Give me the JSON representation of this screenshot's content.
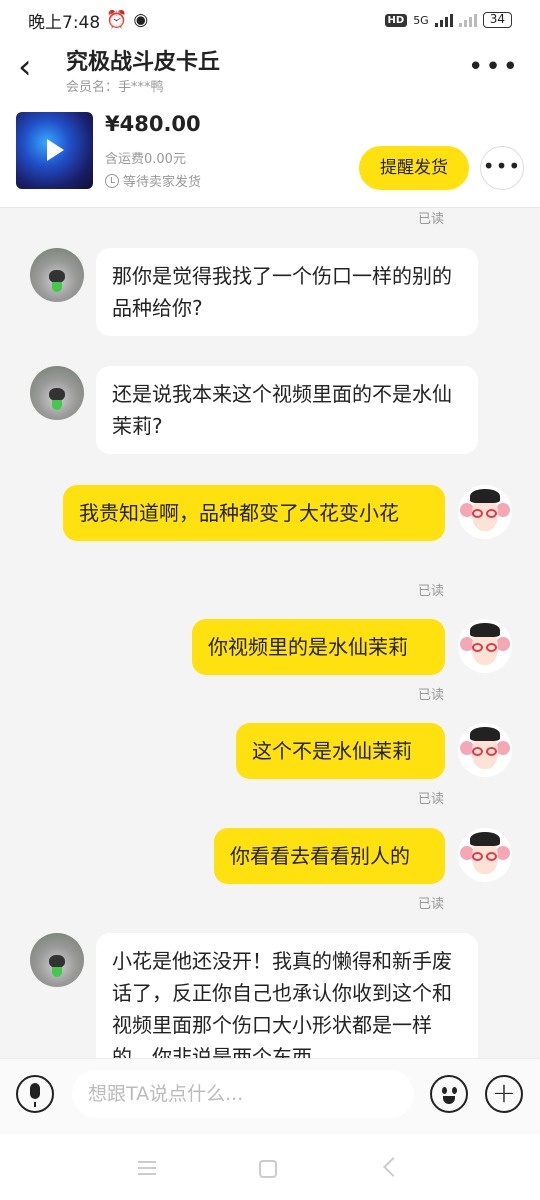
{
  "status_bar": {
    "time": "晚上7:48",
    "hd": "HD",
    "network": "5G",
    "battery": "34"
  },
  "header": {
    "back_icon": "chevron-left-icon",
    "title": "究极战斗皮卡丘",
    "subtitle": "会员名：手***鸭",
    "more_icon": "more-horizontal-icon"
  },
  "product": {
    "price": "¥480.00",
    "shipping_fee": "含运费0.00元",
    "status": "等待卖家发货",
    "remind_button": "提醒发货"
  },
  "chat": {
    "read_label": "已读",
    "messages": [
      {
        "from": "other",
        "text": "那你是觉得我找了一个伤口一样的别的品种给你?"
      },
      {
        "from": "other",
        "text": "还是说我本来这个视频里面的不是水仙茉莉?"
      },
      {
        "from": "me",
        "text": "我贵知道啊，品种都变了大花变小花",
        "status": "已读"
      },
      {
        "from": "me",
        "text": "你视频里的是水仙茉莉",
        "status": "已读"
      },
      {
        "from": "me",
        "text": "这个不是水仙茉莉",
        "status": "已读"
      },
      {
        "from": "me",
        "text": "你看看去看看别人的",
        "status": "已读"
      },
      {
        "from": "other",
        "text": "小花是他还没开！我真的懒得和新手废话了，反正你自己也承认你收到这个和视频里面那个伤口大小形状都是一样的，你非说是两个东西"
      }
    ]
  },
  "input_bar": {
    "placeholder": "想跟TA说点什么..."
  },
  "colors": {
    "accent": "#ffe10f",
    "background": "#f4f4f4"
  }
}
